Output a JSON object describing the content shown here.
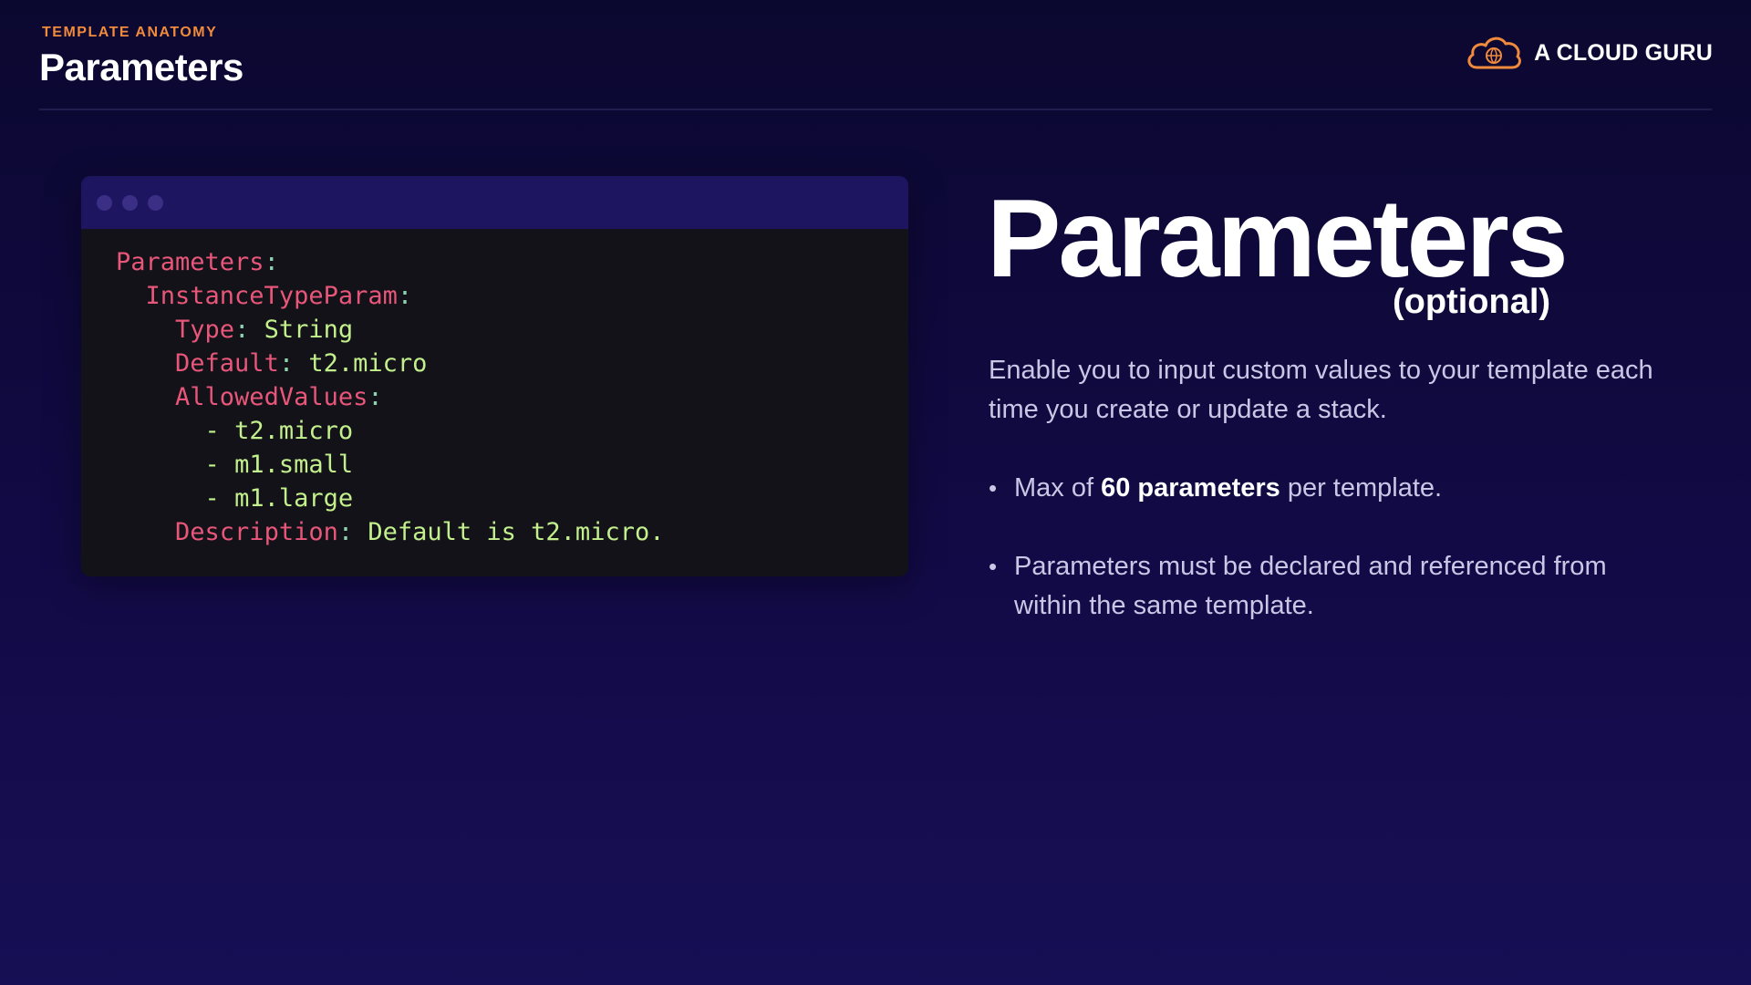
{
  "header": {
    "eyebrow": "TEMPLATE ANATOMY",
    "title": "Parameters"
  },
  "brand": {
    "icon": "cloud-logo-icon",
    "name": "A CLOUD GURU",
    "accent_color": "#f08a3c"
  },
  "code": {
    "window_dots": 3,
    "lines": [
      {
        "key": "Parameters",
        "sep": ":",
        "value": ""
      },
      {
        "key": "InstanceTypeParam",
        "sep": ":",
        "value": ""
      },
      {
        "key": "Type",
        "sep": ": ",
        "value": "String"
      },
      {
        "key": "Default",
        "sep": ": ",
        "value": "t2.micro"
      },
      {
        "key": "AllowedValues",
        "sep": ":",
        "value": ""
      },
      {
        "dash": "- ",
        "value": "t2.micro"
      },
      {
        "dash": "- ",
        "value": "m1.small"
      },
      {
        "dash": "- ",
        "value": "m1.large"
      },
      {
        "key": "Description",
        "sep": ": ",
        "value": "Default is t2.micro."
      }
    ]
  },
  "main": {
    "title": "Parameters",
    "subtitle": "(optional)",
    "intro": "Enable you to input custom values to your template each time you create or update a stack.",
    "bullets": [
      {
        "before": "Max of ",
        "bold": "60 parameters",
        "after": " per template."
      },
      {
        "before": "Parameters must be declared and referenced from within the same template.",
        "bold": "",
        "after": ""
      }
    ]
  },
  "colors": {
    "code_key": "#e8567a",
    "code_value": "#c3f08d",
    "code_punct": "#8ed1b0",
    "background": "#120a45"
  }
}
